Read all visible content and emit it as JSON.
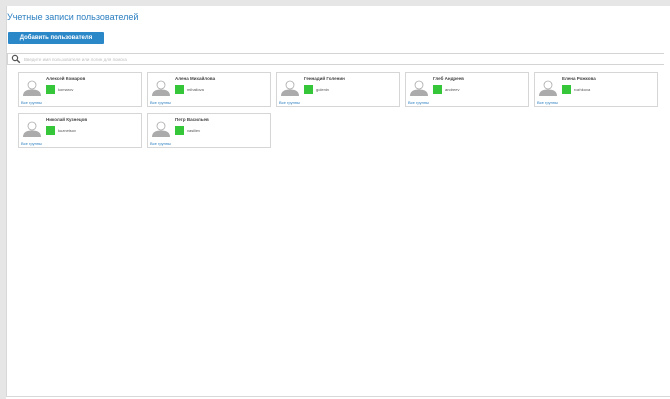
{
  "page": {
    "title": "Учетные записи пользователей",
    "add_button_label": "Добавить пользователя"
  },
  "search": {
    "placeholder": "Введите имя пользователя или логин для поиска"
  },
  "colors": {
    "accent": "#2a87c8",
    "title_color": "#2c7fc0",
    "status_online": "#35c63a"
  },
  "users": [
    {
      "name": "Алексей Комаров",
      "login": "komarov",
      "link": "Все группы"
    },
    {
      "name": "Алена Михайлова",
      "login": "mihailova",
      "link": "Все группы"
    },
    {
      "name": "Геннадий Голенин",
      "login": "golenin",
      "link": "Все группы"
    },
    {
      "name": "Глеб Андреев",
      "login": "andreev",
      "link": "Все группы"
    },
    {
      "name": "Елена Рожкова",
      "login": "rozhkova",
      "link": "Все группы"
    },
    {
      "name": "Николай Кузнецов",
      "login": "kuznetsov",
      "link": "Все группы"
    },
    {
      "name": "Петр Васильев",
      "login": "vasiliev",
      "link": "Все группы"
    }
  ]
}
